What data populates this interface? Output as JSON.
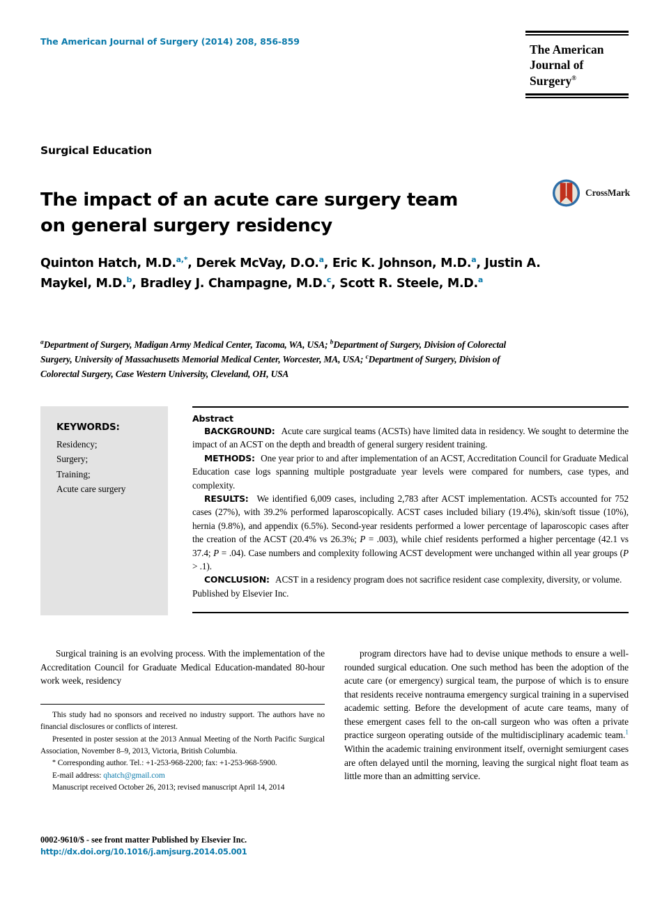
{
  "header": {
    "journal_reference": "The American Journal of Surgery (2014) 208, 856-859",
    "logo_line1": "The American",
    "logo_line2": "Journal of Surgery",
    "logo_trademark": "®"
  },
  "article": {
    "section_label": "Surgical Education",
    "title": "The impact of an acute care surgery team on general surgery residency",
    "crossmark_label": "CrossMark",
    "authors_html": "Quinton Hatch, M.D.<sup>a,</sup><sup>*</sup>, Derek McVay, D.O.<sup>a</sup>, Eric K. Johnson, M.D.<sup>a</sup>, Justin A. Maykel, M.D.<sup>b</sup>, Bradley J. Champagne, M.D.<sup>c</sup>, Scott R. Steele, M.D.<sup>a</sup>",
    "affiliations_html": "<sup>a</sup>Department of Surgery, Madigan Army Medical Center, Tacoma, WA, USA; <sup>b</sup>Department of Surgery, Division of Colorectal Surgery, University of Massachusetts Memorial Medical Center, Worcester, MA, USA; <sup>c</sup>Department of Surgery, Division of Colorectal Surgery, Case Western University, Cleveland, OH, USA"
  },
  "keywords": {
    "title": "KEYWORDS:",
    "items": [
      "Residency;",
      "Surgery;",
      "Training;",
      "Acute care surgery"
    ]
  },
  "abstract": {
    "heading": "Abstract",
    "background_label": "BACKGROUND:",
    "background_text": "Acute care surgical teams (ACSTs) have limited data in residency. We sought to determine the impact of an ACST on the depth and breadth of general surgery resident training.",
    "methods_label": "METHODS:",
    "methods_text": "One year prior to and after implementation of an ACST, Accreditation Council for Graduate Medical Education case logs spanning multiple postgraduate year levels were compared for numbers, case types, and complexity.",
    "results_label": "RESULTS:",
    "results_html": "We identified 6,009 cases, including 2,783 after ACST implementation. ACSTs accounted for 752 cases (27%), with 39.2% performed laparoscopically. ACST cases included biliary (19.4%), skin/soft tissue (10%), hernia (9.8%), and appendix (6.5%). Second-year residents performed a lower percentage of laparoscopic cases after the creation of the ACST (20.4% vs 26.3%; <i>P</i> = .003), while chief residents performed a higher percentage (42.1 vs 37.4; <i>P</i> = .04). Case numbers and complexity following ACST development were unchanged within all year groups (<i>P</i> &gt; .1).",
    "conclusion_label": "CONCLUSION:",
    "conclusion_text": "ACST in a residency program does not sacrifice resident case complexity, diversity, or volume.",
    "publisher_line": "Published by Elsevier Inc."
  },
  "body": {
    "left_column_html": "Surgical training is an evolving process. With the implementation of the Accreditation Council for Graduate Medical Education-mandated 80-hour work week, residency",
    "right_column_html": "program directors have had to devise unique methods to ensure a well-rounded surgical education. One such method has been the adoption of the acute care (or emergency) surgical team, the purpose of which is to ensure that residents receive nontrauma emergency surgical training in a supervised academic setting. Before the development of acute care teams, many of these emergent cases fell to the on-call surgeon who was often a private practice surgeon operating outside of the multidisciplinary academic team.<sup class=\"cite\">1</sup> Within the academic training environment itself, overnight semiurgent cases are often delayed until the morning, leaving the surgical night float team as little more than an admitting service."
  },
  "footnotes": {
    "disclosure": "This study had no sponsors and received no industry support. The authors have no financial disclosures or conflicts of interest.",
    "presentation": "Presented in poster session at the 2013 Annual Meeting of the North Pacific Surgical Association, November 8–9, 2013, Victoria, British Columbia.",
    "corresponding_prefix": "Corresponding author. Tel.: +1-253-968-2200; fax: +1-253-968-5900.",
    "email_label": "E-mail address:",
    "email_address": "qhatch@gmail.com",
    "manuscript_dates": "Manuscript received October 26, 2013; revised manuscript April 14, 2014"
  },
  "bottom": {
    "front_matter": "0002-9610/$ - see front matter Published by Elsevier Inc.",
    "doi_url": "http://dx.doi.org/10.1016/j.amjsurg.2014.05.001"
  },
  "colors": {
    "link_blue": "#0b7aab",
    "keyword_box_gray": "#e3e3e3",
    "crossmark_blue": "#2e6fa8",
    "crossmark_red": "#c0301c"
  }
}
